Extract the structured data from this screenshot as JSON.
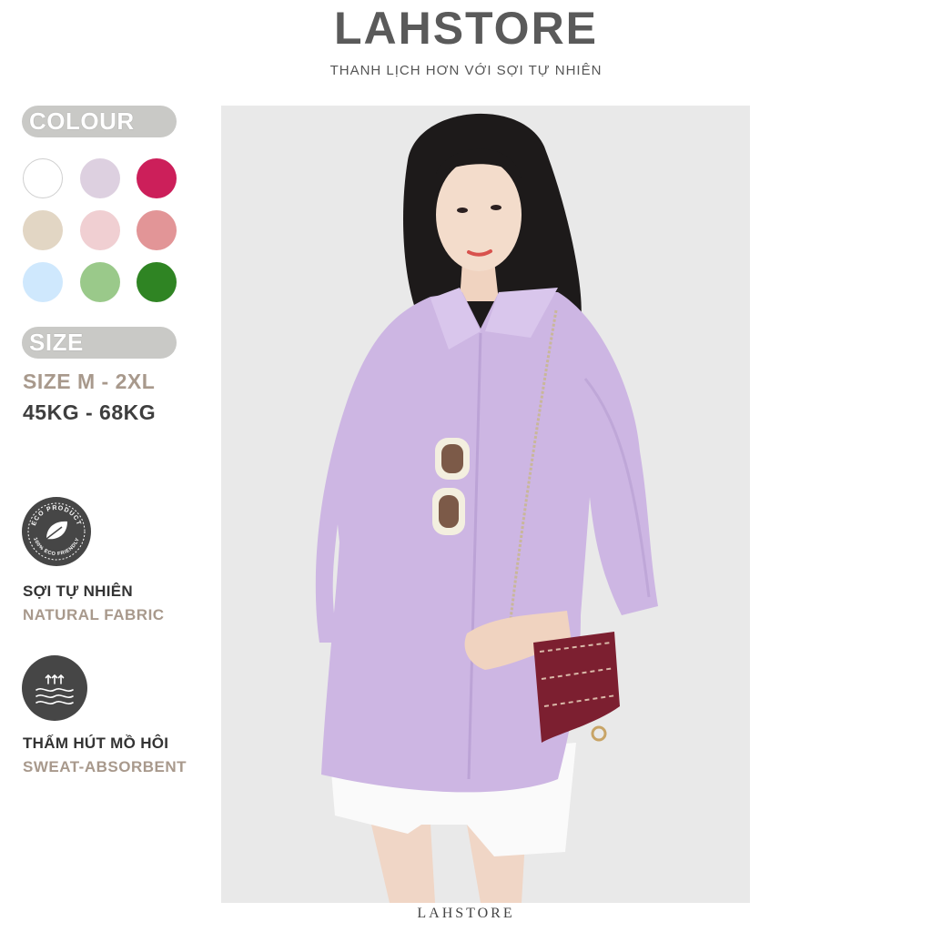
{
  "header": {
    "brand": "LAHSTORE",
    "tagline": "THANH LỊCH HƠN VỚI SỢI TỰ NHIÊN"
  },
  "colour_section": {
    "label": "COLOUR",
    "swatches": [
      "#ffffff",
      "#ddd0e0",
      "#cc1f5a",
      "#e2d6c4",
      "#f0cfd2",
      "#e29597",
      "#cfe8fd",
      "#9ac98a",
      "#2f8423"
    ]
  },
  "size_section": {
    "label": "SIZE",
    "range": "SIZE M - 2XL",
    "weight": "45KG - 68KG"
  },
  "features": [
    {
      "icon": "eco-product-badge-icon",
      "badge_text": "ECO PRODUCT · 100% ECO FRIENDLY",
      "title": "SỢI TỰ NHIÊN",
      "subtitle": "NATURAL FABRIC"
    },
    {
      "icon": "sweat-absorbent-icon",
      "title": "THẤM HÚT MỒ HÔI",
      "subtitle": "SWEAT-ABSORBENT"
    }
  ],
  "photo": {
    "alt_icon": "model-wearing-lavender-shirt",
    "shirt_color": "#cdb6e3"
  },
  "footer": {
    "brand": "LAHSTORE"
  }
}
